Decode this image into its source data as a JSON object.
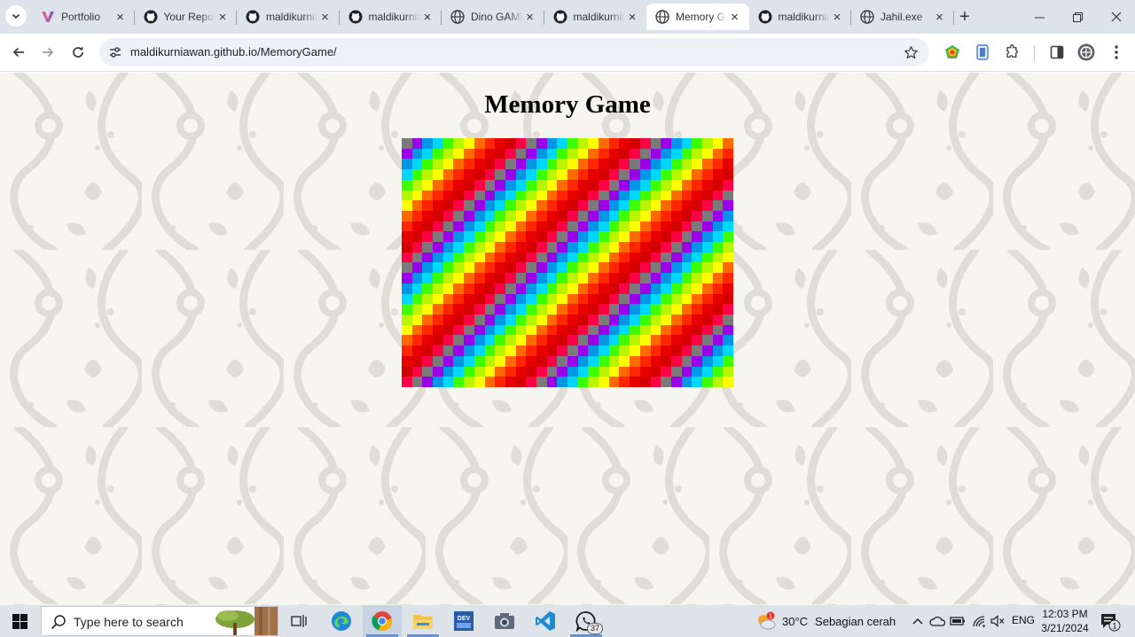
{
  "browser": {
    "tabs": [
      {
        "title": "Portfolio",
        "favicon": "portfolio-v-icon",
        "active": false
      },
      {
        "title": "Your Repositories",
        "favicon": "github-icon",
        "active": false
      },
      {
        "title": "maldikurniawan",
        "favicon": "github-icon",
        "active": false
      },
      {
        "title": "maldikurniawan",
        "favicon": "github-icon",
        "active": false
      },
      {
        "title": "Dino GAME",
        "favicon": "globe-icon",
        "active": false
      },
      {
        "title": "maldikurniawan",
        "favicon": "github-icon",
        "active": false
      },
      {
        "title": "Memory Game",
        "favicon": "globe-icon",
        "active": true
      },
      {
        "title": "maldikurniawan",
        "favicon": "github-icon",
        "active": false
      },
      {
        "title": "Jahil.exe",
        "favicon": "globe-icon",
        "active": false
      }
    ],
    "close_glyph": "×",
    "new_tab_glyph": "+",
    "url": "maldikurniawan.github.io/MemoryGame/"
  },
  "page": {
    "title": "Memory Game",
    "board": {
      "columns": 32,
      "rows": 24,
      "palette": [
        "#7a7a7a",
        "#9b00e8",
        "#0096e6",
        "#00d7ff",
        "#3cff00",
        "#b8f500",
        "#ffff00",
        "#ff6a00",
        "#ff2600",
        "#e60000",
        "#d40000",
        "#ff0046"
      ]
    }
  },
  "taskbar": {
    "search_placeholder": "Type here to search",
    "whatsapp_badge": "37",
    "weather_temp": "30°C",
    "weather_desc": "Sebagian cerah",
    "weather_alert": "1",
    "language": "ENG",
    "time": "12:03 PM",
    "date": "3/21/2024",
    "notification_count": "1"
  },
  "colors": {
    "tabstrip": "#dde3ea",
    "omnibox": "#eef1f5",
    "page_background": "#f7f5ef",
    "pattern": "#dfddd5",
    "taskbar": "#dee3ea"
  }
}
